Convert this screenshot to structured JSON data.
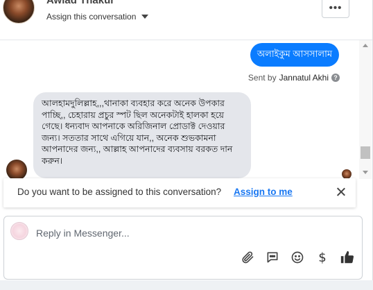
{
  "header": {
    "contact_name": "Awlad Thakur",
    "assign_label": "Assign this conversation",
    "more_label": "•••"
  },
  "messages": {
    "outgoing": {
      "text": "অলাইকুম আসসালাম",
      "sent_by_prefix": "Sent by",
      "agent": "Jannatul Akhi",
      "help_icon": "?"
    },
    "incoming": {
      "text": "আলহামদুলিল্লাহ,,,থানাকা ব্যবহার করে অনেক উপকার পাচ্ছি,, চেহারায় প্রচুর স্পট ছিল অনেকটাই হালকা হয়ে গেছে। ধন্যবাদ আপনাকে অরিজিনাল প্রোডাক্ট দেওয়ার জন্য। সততার সাথে এগিয়ে যান,, অনেক শুভকামনা আপনাদের জন্য,, আল্লাহ আপনাদের ব্যবসায় বরকত দান করুন।"
    }
  },
  "assign_banner": {
    "question": "Do you want to be assigned to this conversation?",
    "action": "Assign to me"
  },
  "composer": {
    "placeholder": "Reply in Messenger..."
  },
  "colors": {
    "accent": "#0a7cff",
    "link": "#1877f2",
    "incoming_bubble": "#e4e6eb"
  }
}
